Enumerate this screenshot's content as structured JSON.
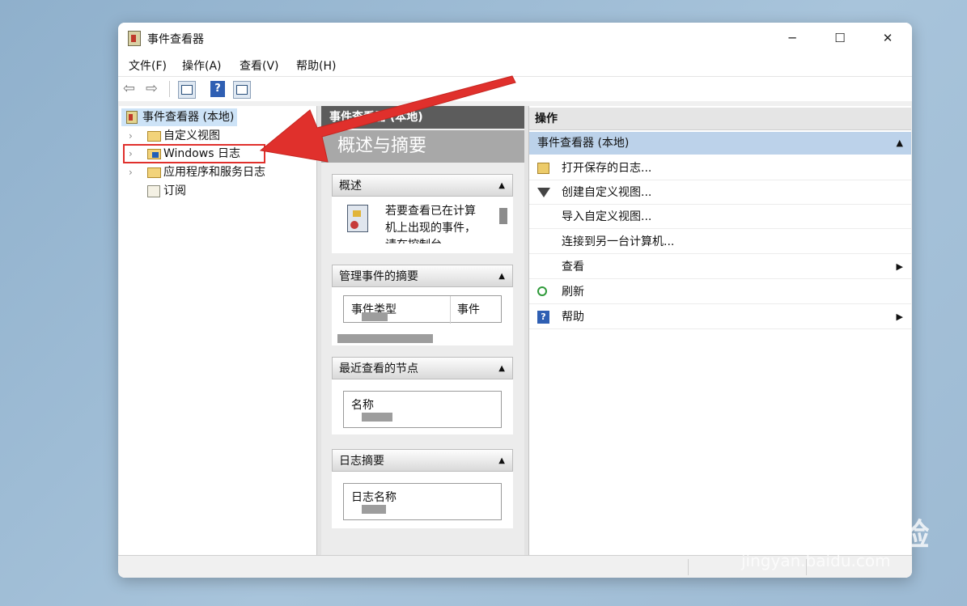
{
  "window": {
    "title": "事件查看器",
    "minimize": "─",
    "maximize": "☐",
    "close": "✕"
  },
  "menu": [
    "文件(F)",
    "操作(A)",
    "查看(V)",
    "帮助(H)"
  ],
  "toolbar": {
    "back": "⇦",
    "forward": "⇨",
    "help": "?"
  },
  "tree": {
    "root": "事件查看器 (本地)",
    "items": [
      {
        "label": "自定义视图",
        "expand": "›"
      },
      {
        "label": "Windows 日志",
        "expand": "›"
      },
      {
        "label": "应用程序和服务日志",
        "expand": "›"
      },
      {
        "label": "订阅",
        "expand": ""
      }
    ]
  },
  "middle": {
    "header": "事件查看器 (本地)",
    "subheader": "概述与摘要",
    "overview": {
      "title": "概述",
      "text": "若要查看已在计算机上出现的事件，请在控制台"
    },
    "summary": {
      "title": "管理事件的摘要",
      "col1": "事件类型",
      "col2": "事件"
    },
    "recent": {
      "title": "最近查看的节点",
      "col1": "名称"
    },
    "logs": {
      "title": "日志摘要",
      "col1": "日志名称"
    },
    "collapse_arrow": "▲"
  },
  "actions": {
    "header": "操作",
    "group": "事件查看器 (本地)",
    "group_arrow": "▲",
    "items": [
      {
        "label": "打开保存的日志...",
        "submenu": ""
      },
      {
        "label": "创建自定义视图...",
        "submenu": ""
      },
      {
        "label": "导入自定义视图...",
        "submenu": ""
      },
      {
        "label": "连接到另一台计算机...",
        "submenu": ""
      },
      {
        "label": "查看",
        "submenu": "▶"
      },
      {
        "label": "刷新",
        "submenu": ""
      },
      {
        "label": "帮助",
        "submenu": "▶"
      }
    ]
  },
  "annotation": {
    "color": "#e0302c"
  },
  "watermark": {
    "logo": "Bai du 经验",
    "url": "jingyan.baidu.com"
  }
}
